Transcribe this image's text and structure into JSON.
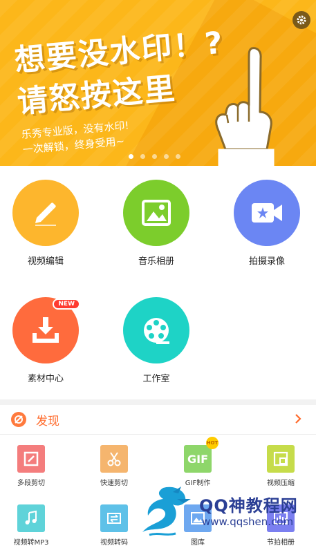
{
  "banner": {
    "headline_line1": "想要没水印！?",
    "headline_line2": "请怒按这里",
    "subline1": "乐秀专业版，没有水印!",
    "subline2": "一次解锁，终身受用~",
    "dots_count": 5,
    "active_dot": 1
  },
  "tools": [
    {
      "label": "视频编辑",
      "icon": "pencil-icon",
      "color": "#fdb62d"
    },
    {
      "label": "音乐相册",
      "icon": "image-icon",
      "color": "#7ccd2c"
    },
    {
      "label": "拍摄录像",
      "icon": "video-camera-icon",
      "color": "#6b86f3"
    },
    {
      "label": "素材中心",
      "icon": "download-icon",
      "color": "#ff6b3d",
      "badge": "NEW"
    },
    {
      "label": "工作室",
      "icon": "film-reel-icon",
      "color": "#1ed3c6"
    }
  ],
  "discover": {
    "title": "发现"
  },
  "mini_tools": [
    {
      "label": "多段剪切",
      "icon": "multi-cut-icon",
      "color": "#f47d7d"
    },
    {
      "label": "快速剪切",
      "icon": "scissors-icon",
      "color": "#f5b56e"
    },
    {
      "label": "GIF制作",
      "icon": "gif-icon",
      "color": "#8ed66a",
      "text": "GIF",
      "hot": "HOT"
    },
    {
      "label": "视频压缩",
      "icon": "compress-icon",
      "color": "#c6dc4a"
    },
    {
      "label": "视频转MP3",
      "icon": "music-note-icon",
      "color": "#5fd3d9"
    },
    {
      "label": "视频转码",
      "icon": "transcode-icon",
      "color": "#5ec1e8"
    },
    {
      "label": "图库",
      "icon": "gallery-icon",
      "color": "#6ea8f0"
    },
    {
      "label": "节拍相册",
      "icon": "beat-album-icon",
      "color": "#7b7ff0"
    }
  ],
  "watermark": {
    "title": "QQ神教程网",
    "url": "www.qqshen.com"
  }
}
